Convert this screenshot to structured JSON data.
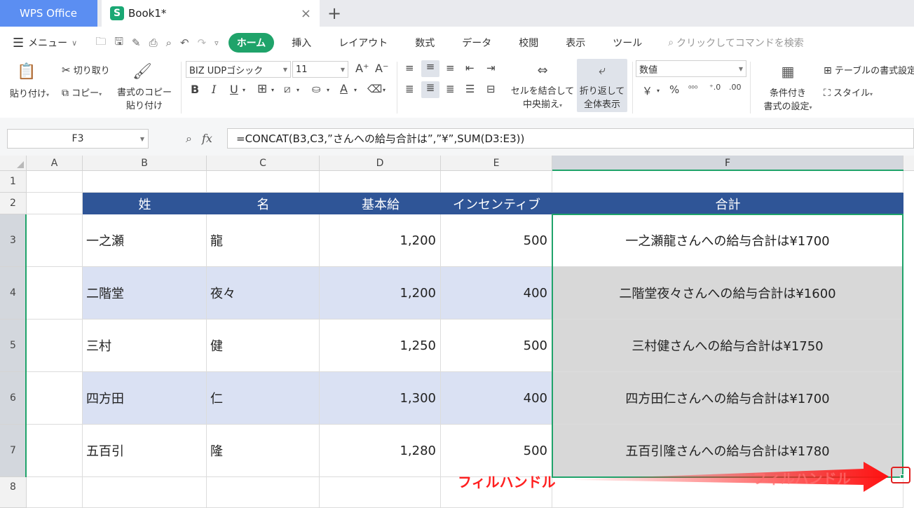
{
  "titlebar": {
    "app_tab": "WPS Office",
    "doc_tab": "Book1*",
    "doc_icon": "S",
    "close_glyph": "×",
    "new_tab_glyph": "+"
  },
  "menubar": {
    "menu_label": "メニュー",
    "tabs": [
      {
        "label": "ホーム",
        "active": true
      },
      {
        "label": "挿入"
      },
      {
        "label": "レイアウト"
      },
      {
        "label": "数式"
      },
      {
        "label": "データ"
      },
      {
        "label": "校閲"
      },
      {
        "label": "表示"
      },
      {
        "label": "ツール"
      }
    ],
    "search_placeholder": "クリックしてコマンドを検索"
  },
  "ribbon": {
    "paste": "貼り付け",
    "cut": "切り取り",
    "copy": "コピー",
    "format_painter_1": "書式のコピー",
    "format_painter_2": "貼り付け",
    "font_name": "BIZ UDPゴシック",
    "font_size": "11",
    "merge_1": "セルを結合して",
    "merge_2": "中央揃え",
    "wrap_1": "折り返して",
    "wrap_2": "全体表示",
    "number_format": "数値",
    "currency": "￥",
    "percent": "%",
    "cond_1": "条件付き",
    "cond_2": "書式の設定",
    "table_format": "テーブルの書式設定",
    "style": "スタイル"
  },
  "formula_bar": {
    "name_box": "F3",
    "fx": "fx",
    "formula": "=CONCAT(B3,C3,”さんへの給与合計は”,”¥”,SUM(D3:E3))"
  },
  "grid": {
    "columns": [
      "A",
      "B",
      "C",
      "D",
      "E",
      "F"
    ],
    "rows": [
      "1",
      "2",
      "3",
      "4",
      "5",
      "6",
      "7",
      "8"
    ],
    "selected_column": "F",
    "header_row": [
      "姓",
      "名",
      "基本給",
      "インセンティブ",
      "合計"
    ],
    "data": [
      [
        "一之瀬",
        "龍",
        "1,200",
        "500",
        "一之瀬龍さんへの給与合計は¥1700"
      ],
      [
        "二階堂",
        "夜々",
        "1,200",
        "400",
        "二階堂夜々さんへの給与合計は¥1600"
      ],
      [
        "三村",
        "健",
        "1,250",
        "500",
        "三村健さんへの給与合計は¥1750"
      ],
      [
        "四方田",
        "仁",
        "1,300",
        "400",
        "四方田仁さんへの給与合計は¥1700"
      ],
      [
        "五百引",
        "隆",
        "1,280",
        "500",
        "五百引隆さんへの給与合計は¥1780"
      ]
    ]
  },
  "annotations": {
    "label": "フィルハンドル",
    "ghost_label": "フィルハンドル",
    "color": "#ff2020"
  },
  "colors": {
    "accent": "#1fa36a",
    "header_fill": "#2f5597",
    "band_fill": "#dae1f3",
    "wps_blue": "#5b8ef2"
  }
}
